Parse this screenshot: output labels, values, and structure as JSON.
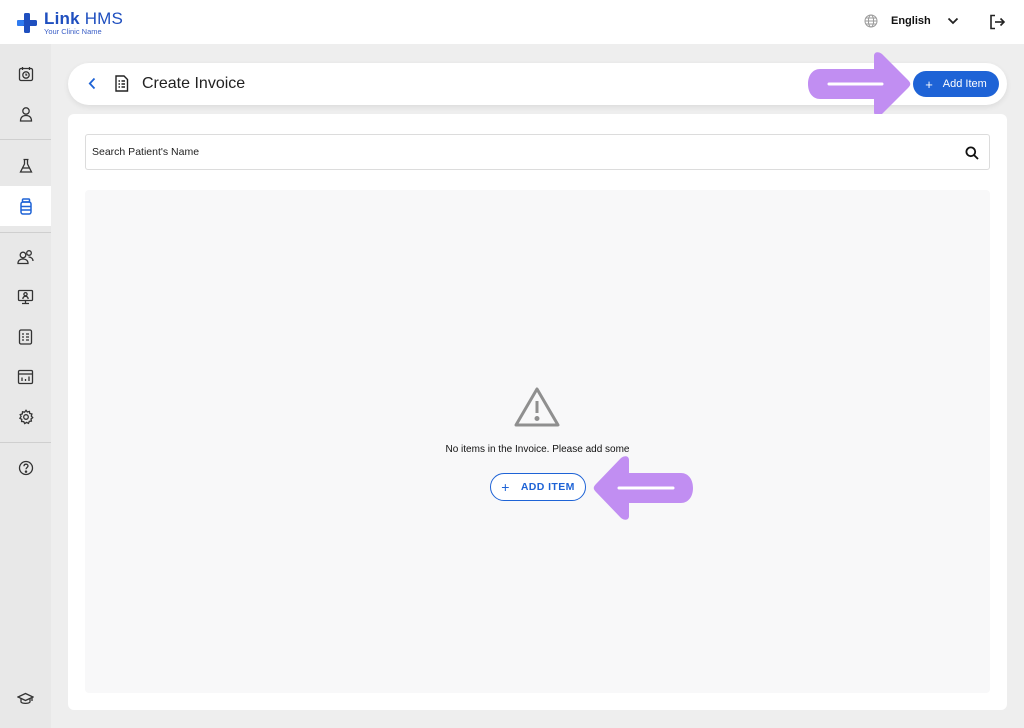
{
  "app": {
    "name_bold": "Link",
    "name_regular": "HMS",
    "subtitle": "Your Clinic Name"
  },
  "topbar": {
    "language": "English",
    "icons": [
      "globe-icon",
      "chevron-down-icon",
      "logout-icon"
    ]
  },
  "sidebar": {
    "items": [
      {
        "icon": "clock-calendar-icon",
        "active": false
      },
      {
        "icon": "user-icon",
        "active": false
      },
      {
        "icon": "lab-flask-icon",
        "active": false
      },
      {
        "icon": "medicine-bottle-icon",
        "active": true
      },
      {
        "icon": "users-icon",
        "active": false
      },
      {
        "icon": "monitor-icon",
        "active": false
      },
      {
        "icon": "report-icon",
        "active": false
      },
      {
        "icon": "analytics-icon",
        "active": false
      },
      {
        "icon": "settings-icon",
        "active": false
      },
      {
        "icon": "help-icon",
        "active": false
      },
      {
        "icon": "graduation-cap-icon",
        "active": false
      }
    ]
  },
  "header": {
    "title": "Create Invoice",
    "add_button_label": "Add Item"
  },
  "search": {
    "placeholder": "Search Patient's Name"
  },
  "empty_state": {
    "message": "No items in the Invoice. Please add some",
    "button_label": "ADD ITEM"
  },
  "colors": {
    "accent": "#1e63d6",
    "annotation_arrow": "#c18ef2",
    "brand": "#1f4fbf"
  }
}
